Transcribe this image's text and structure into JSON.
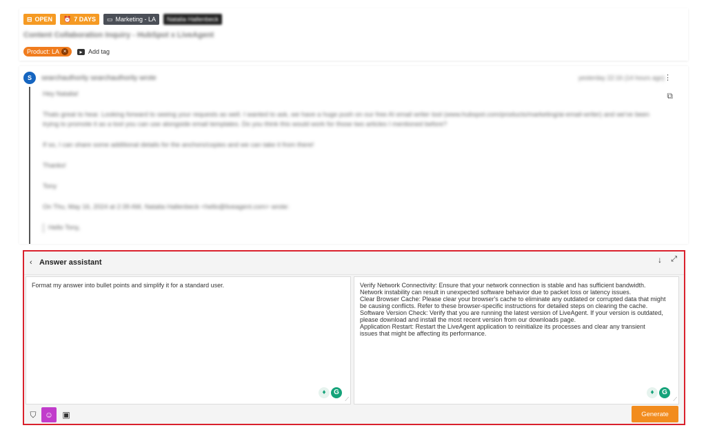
{
  "ticket": {
    "status_badge": "OPEN",
    "age_badge": "7 DAYS",
    "department_badge": "Marketing - LA",
    "agent_badge": "Natalia Hallenbeck",
    "subject": "Content Collaboration Inquiry - HubSpot x LiveAgent",
    "tag_label": "Product: LA",
    "add_tag_label": "Add tag"
  },
  "message": {
    "avatar_initial": "S",
    "from": "searchauthority searchauthority wrote",
    "time": "yesterday 22:16 (14 hours ago)",
    "body": [
      "Hey Natalia!",
      "Thats great to hear. Looking forward to seeing your requests as well. I wanted to ask, we have a huge push on our free AI email writer tool (www.hubspot.com/products/marketing/ai-email-writer) and we've been trying to promote it as a tool you can use alongside email templates. Do you think this would work for those two articles I mentioned before?",
      "If so, I can share some additional details for the anchors/copies and we can take it from there!",
      "Thanks!",
      "Tony",
      "On Thu, May 16, 2024 at 2:39 AM, Natalia Hallenbeck <hello@liveagent.com> wrote:"
    ],
    "quote": "Hello Tony,"
  },
  "assistant": {
    "back_icon": "chevron-left-icon",
    "title": "Answer assistant",
    "prompt_text": "Format my answer into bullet points and simplify it for a standard user.",
    "response_lines": [
      "Verify Network Connectivity: Ensure that your network connection is stable and has sufficient bandwidth.",
      "Network instability can result in unexpected software behavior due to packet loss or latency issues.",
      "Clear Browser Cache: Please clear your browser's cache to eliminate any outdated or corrupted data that might",
      "be causing conflicts. Refer to these browser-specific instructions for detailed steps on clearing the cache.",
      "Software Version Check: Verify that you are running the latest version of LiveAgent. If your version is outdated,",
      "please download and install the most recent version from our downloads page.",
      "Application Restart: Restart the LiveAgent application to reinitialize its processes and clear any transient",
      "issues that might be affecting its performance."
    ],
    "generate_label": "Generate"
  },
  "colors": {
    "accent_orange": "#f28c1e",
    "highlight_border": "#d9202c",
    "active_tool": "#c13ccb",
    "avatar_blue": "#1565c0",
    "grammarly_green": "#15a37a"
  }
}
